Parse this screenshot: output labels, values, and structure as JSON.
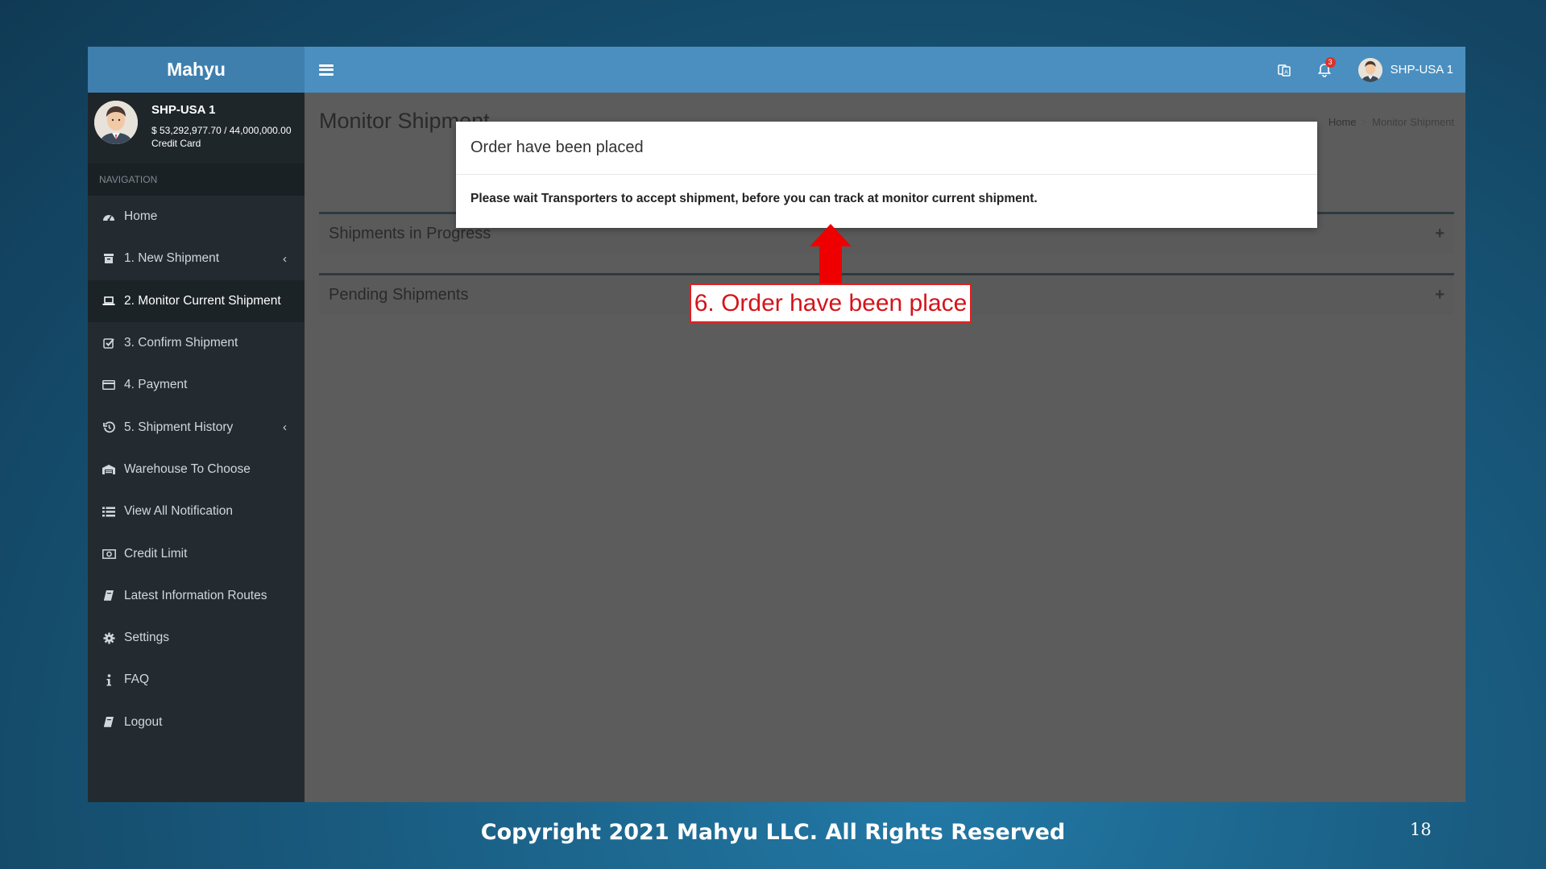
{
  "app": {
    "brand": "Mahyu",
    "user_name": "SHP-USA 1",
    "notification_count": "3"
  },
  "sidebar": {
    "user": {
      "name": "SHP-USA 1",
      "balance": "$ 53,292,977.70 / 44,000,000.00",
      "payment_method": "Credit Card"
    },
    "nav_header": "NAVIGATION",
    "items": [
      {
        "label": "Home",
        "icon": "dashboard-icon"
      },
      {
        "label": "1. New Shipment",
        "icon": "box-icon",
        "has_submenu": true
      },
      {
        "label": "2. Monitor Current Shipment",
        "icon": "laptop-icon",
        "active": true
      },
      {
        "label": "3. Confirm Shipment",
        "icon": "check-square-icon"
      },
      {
        "label": "4. Payment",
        "icon": "credit-card-icon"
      },
      {
        "label": "5. Shipment History",
        "icon": "history-icon",
        "has_submenu": true
      },
      {
        "label": "Warehouse To Choose",
        "icon": "warehouse-icon"
      },
      {
        "label": "View All Notification",
        "icon": "list-icon"
      },
      {
        "label": "Credit Limit",
        "icon": "money-icon"
      },
      {
        "label": "Latest Information Routes",
        "icon": "book-icon"
      },
      {
        "label": "Settings",
        "icon": "gear-icon"
      },
      {
        "label": "FAQ",
        "icon": "info-icon"
      },
      {
        "label": "Logout",
        "icon": "book-icon"
      }
    ]
  },
  "main": {
    "page_title": "Monitor Shipment",
    "breadcrumb": {
      "home": "Home",
      "current": "Monitor Shipment"
    },
    "boxes": [
      {
        "title": "Shipments in Progress"
      },
      {
        "title": "Pending Shipments"
      }
    ]
  },
  "modal": {
    "title": "Order have been placed",
    "body": "Please wait Transporters to accept shipment, before you can track at monitor current shipment."
  },
  "annotation": {
    "text": "6. Order have been place"
  },
  "footer": {
    "copyright": "Copyright 2021 Mahyu LLC. All Rights Reserved",
    "page_number": "18"
  },
  "colors": {
    "topbar": "#4a8fc0",
    "sidebar": "#232b30",
    "overlay_content": "#5c5c5c",
    "annotation_red": "#e02020"
  }
}
